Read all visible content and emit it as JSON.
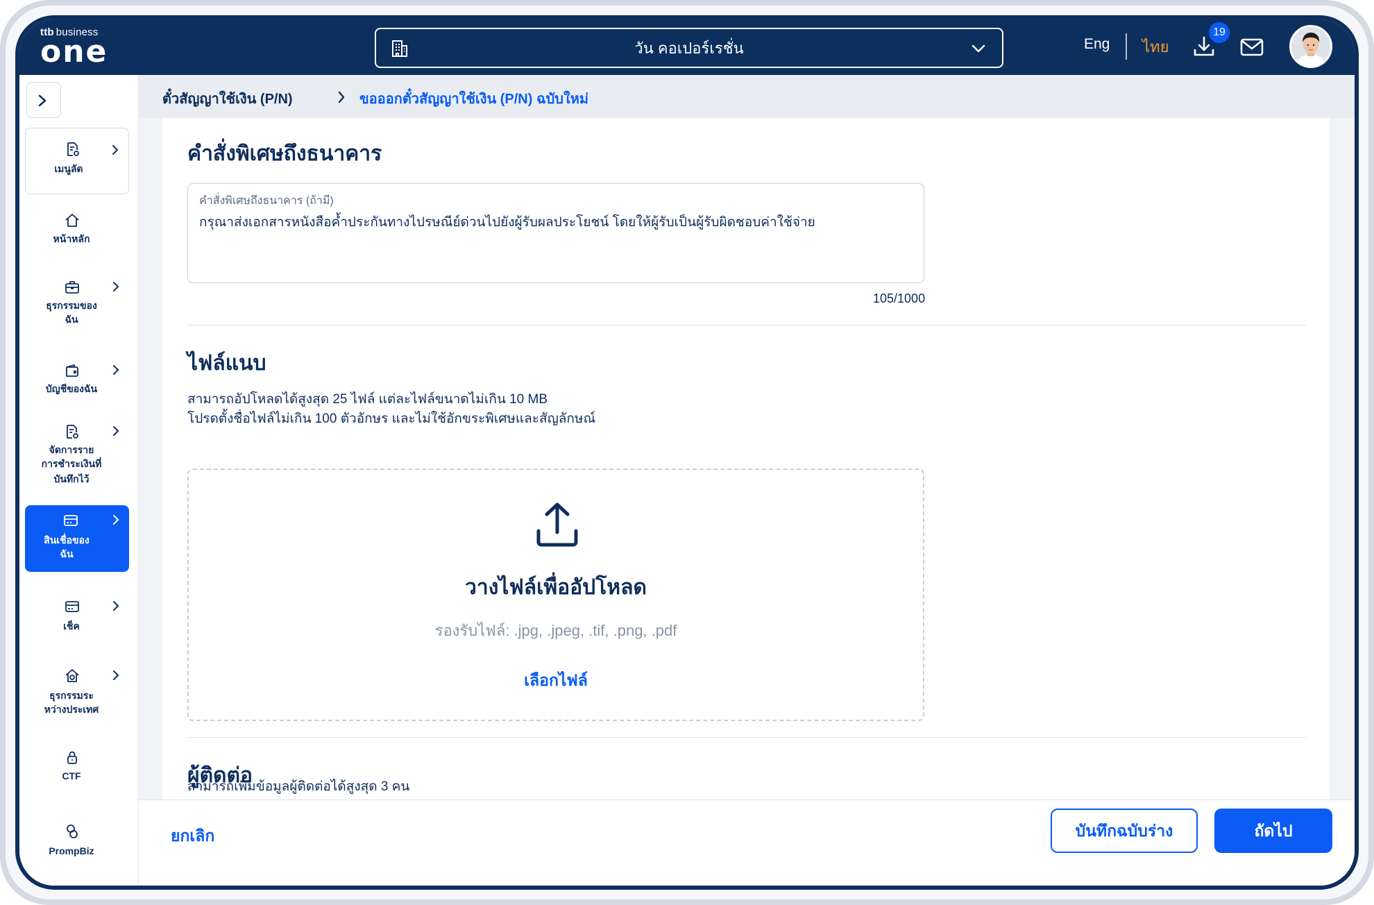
{
  "header": {
    "logo_prefix": "ttb",
    "logo_small": "business",
    "logo_main": "one",
    "company": "วัน คอเปอร์เรชั่น",
    "lang_eng": "Eng",
    "lang_thai": "ไทย",
    "download_badge": "19"
  },
  "sidebar": {
    "items": [
      {
        "label": "เมนูลัด",
        "icon": "document-settings-icon"
      },
      {
        "label": "หน้าหลัก",
        "icon": "home-icon"
      },
      {
        "label": "ธุรกรรมของ",
        "label2": "ฉัน",
        "icon": "briefcase-icon"
      },
      {
        "label": "บัญชีของฉัน",
        "icon": "wallet-icon"
      },
      {
        "label": "จัดการราย",
        "label2": "การชำระเงินที่",
        "label3": "บันทึกไว้",
        "icon": "document-settings-icon"
      },
      {
        "label": "สินเชื่อของ",
        "label2": "ฉัน",
        "icon": "card-icon"
      },
      {
        "label": "เช็ค",
        "icon": "card-icon"
      },
      {
        "label": "ธุรกรรมระ",
        "label2": "หว่างประเทศ",
        "icon": "home-globe-icon"
      },
      {
        "label": "CTF",
        "icon": "lock-icon"
      },
      {
        "label": "PrompBiz",
        "icon": "coins-icon"
      }
    ]
  },
  "breadcrumb": {
    "parent": "ตั๋วสัญญาใช้เงิน (P/N)",
    "current": "ขอออกตั๋วสัญญาใช้เงิน (P/N) ฉบับใหม่"
  },
  "instruction": {
    "title": "คำสั่งพิเศษถึงธนาคาร",
    "field_label": "คำสั่งพิเศษถึงธนาคาร (ถ้ามี)",
    "field_value": "กรุณาส่งเอกสารหนังสือค้ำประกันทางไปรษณีย์ด่วนไปยังผู้รับผลประโยชน์ โดยให้ผู้รับเป็นผู้รับผิดชอบค่าใช้จ่าย",
    "counter": "105/1000"
  },
  "attachment": {
    "title": "ไฟล์แนบ",
    "desc1": "สามารถอัปโหลดได้สูงสุด 25 ไฟล์ แต่ละไฟล์ขนาดไม่เกิน 10 MB",
    "desc2": "โปรดตั้งชื่อไฟล์ไม่เกิน 100 ตัวอักษร และไม่ใช้อักขระพิเศษและสัญลักษณ์",
    "drop_title": "วางไฟล์เพื่ออัปโหลด",
    "drop_types": "รองรับไฟล์: .jpg, .jpeg, .tif, .png, .pdf",
    "pick_label": "เลือกไฟล์"
  },
  "contact": {
    "title": "ผู้ติดต่อ",
    "desc": "สามารถเพิ่มข้อมูลผู้ติดต่อได้สูงสุด 3 คน"
  },
  "footer": {
    "cancel": "ยกเลิก",
    "save_draft": "บันทึกฉบับร่าง",
    "next": "ถัดไป"
  },
  "colors": {
    "navy": "#0d2f5e",
    "primary": "#0a5cf5",
    "accent_orange": "#f29a2e"
  }
}
